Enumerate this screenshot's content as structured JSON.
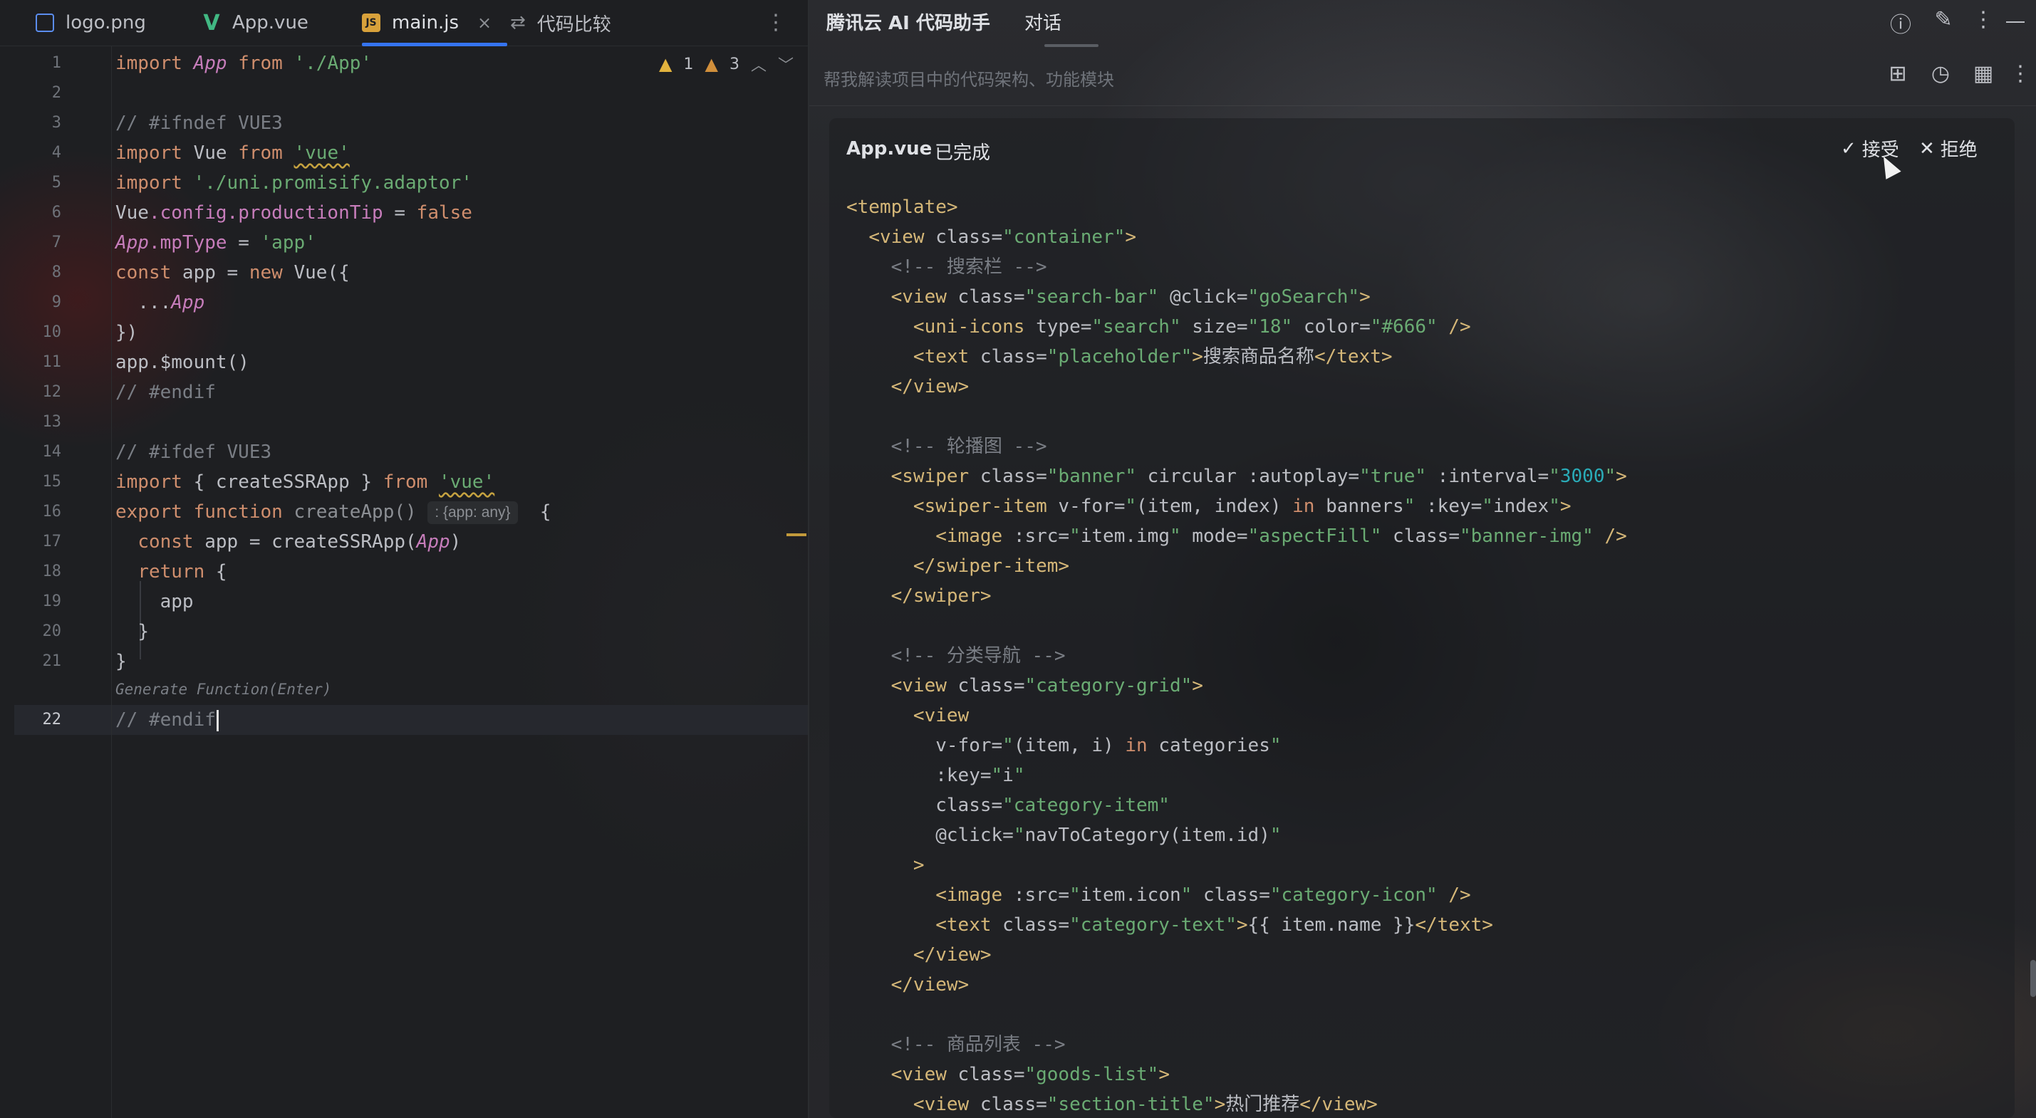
{
  "tabs": [
    {
      "label": "logo.png",
      "icon": "image-file-icon"
    },
    {
      "label": "App.vue",
      "icon": "vue-file-icon"
    },
    {
      "label": "main.js",
      "icon": "js-file-icon",
      "close": "×"
    },
    {
      "label": "代码比较",
      "icon": "diff-icon"
    }
  ],
  "editor": {
    "line_numbers": [
      "1",
      "2",
      "3",
      "4",
      "5",
      "6",
      "7",
      "8",
      "9",
      "10",
      "11",
      "12",
      "13",
      "14",
      "15",
      "16",
      "17",
      "18",
      "19",
      "20",
      "21",
      "22"
    ],
    "inspections": {
      "warn1": "1",
      "warn2": "3"
    },
    "inlay_hint": ": {app: any}",
    "generate_hint": "Generate Function(Enter)",
    "tokens": {
      "import": "import",
      "from": "from",
      "new": "new",
      "false": "false",
      "export": "export",
      "function": "function",
      "return": "return",
      "App": "App",
      "Vue": "Vue",
      "app": "app",
      "p_app": "'./App'",
      "p_vue": "'vue'",
      "p_adaptor": "'./uni.promisify.adaptor'",
      "s_app": "'app'",
      "c_ifndef": "// #ifndef VUE3",
      "c_endif": "// #endif",
      "c_ifdef": "// #ifdef VUE3",
      "config": ".config.",
      "productionTip": "productionTip",
      " eq": " = ",
      "mpType": ".mpType",
      "const": "const",
      "app_eq_new": " app = ",
      "vue_open": " Vue({",
      "spread": "...",
      "close_obj": "})",
      "mount": "app.$mount()",
      "createSSRApp_import": " { createSSRApp } ",
      "createApp": " createApp()",
      "brace_open": "  {",
      "create_call": " app = createSSRApp(",
      "paren_close": ")",
      "ret_brace": " {",
      "close_brace": "}"
    }
  },
  "assistant": {
    "title": "腾讯云 AI 代码助手",
    "tab": "对话",
    "placeholder": "帮我解读项目中的代码架构、功能模块",
    "card": {
      "file": "App.vue",
      "status": "已完成",
      "accept": "接受",
      "reject": "拒绝"
    },
    "code": [
      [
        [
          "tg",
          "<template>"
        ]
      ],
      [
        [
          "tx",
          "  "
        ],
        [
          "tg",
          "<view "
        ],
        [
          "at",
          "class="
        ],
        [
          "av",
          "\"container\""
        ],
        [
          "tg",
          ">"
        ]
      ],
      [
        [
          "tx",
          "    "
        ],
        [
          "hc",
          "<!-- 搜索栏 -->"
        ]
      ],
      [
        [
          "tx",
          "    "
        ],
        [
          "tg",
          "<view "
        ],
        [
          "at",
          "class="
        ],
        [
          "av",
          "\"search-bar\""
        ],
        [
          "at",
          " @click="
        ],
        [
          "av",
          "\"goSearch\""
        ],
        [
          "tg",
          ">"
        ]
      ],
      [
        [
          "tx",
          "      "
        ],
        [
          "tg",
          "<uni-icons "
        ],
        [
          "at",
          "type="
        ],
        [
          "av",
          "\"search\""
        ],
        [
          "at",
          " size="
        ],
        [
          "av",
          "\"18\""
        ],
        [
          "at",
          " color="
        ],
        [
          "av",
          "\"#666\""
        ],
        [
          "tg",
          " />"
        ]
      ],
      [
        [
          "tx",
          "      "
        ],
        [
          "tg",
          "<text "
        ],
        [
          "at",
          "class="
        ],
        [
          "av",
          "\"placeholder\""
        ],
        [
          "tg",
          ">"
        ],
        [
          "tx",
          "搜索商品名称"
        ],
        [
          "tg",
          "</text>"
        ]
      ],
      [
        [
          "tx",
          "    "
        ],
        [
          "tg",
          "</view>"
        ]
      ],
      [
        [
          "tx",
          ""
        ]
      ],
      [
        [
          "tx",
          "    "
        ],
        [
          "hc",
          "<!-- 轮播图 -->"
        ]
      ],
      [
        [
          "tx",
          "    "
        ],
        [
          "tg",
          "<swiper "
        ],
        [
          "at",
          "class="
        ],
        [
          "av",
          "\"banner\""
        ],
        [
          "at",
          " circular :autoplay="
        ],
        [
          "av",
          "\"true\""
        ],
        [
          "at",
          " :interval="
        ],
        [
          "av",
          "\""
        ],
        [
          "num",
          "3000"
        ],
        [
          "av",
          "\""
        ],
        [
          "tg",
          ">"
        ]
      ],
      [
        [
          "tx",
          "      "
        ],
        [
          "tg",
          "<swiper-item "
        ],
        [
          "at",
          "v-for="
        ],
        [
          "av",
          "\""
        ],
        [
          "tx",
          "(item, index) "
        ],
        [
          "in",
          "in"
        ],
        [
          "tx",
          " banners"
        ],
        [
          "av",
          "\""
        ],
        [
          "at",
          " :key="
        ],
        [
          "av",
          "\""
        ],
        [
          "tx",
          "index"
        ],
        [
          "av",
          "\""
        ],
        [
          "tg",
          ">"
        ]
      ],
      [
        [
          "tx",
          "        "
        ],
        [
          "tg",
          "<image "
        ],
        [
          "at",
          ":src="
        ],
        [
          "av",
          "\""
        ],
        [
          "tx",
          "item.img"
        ],
        [
          "av",
          "\""
        ],
        [
          "at",
          " mode="
        ],
        [
          "av",
          "\"aspectFill\""
        ],
        [
          "at",
          " class="
        ],
        [
          "av",
          "\"banner-img\""
        ],
        [
          "tg",
          " />"
        ]
      ],
      [
        [
          "tx",
          "      "
        ],
        [
          "tg",
          "</swiper-item>"
        ]
      ],
      [
        [
          "tx",
          "    "
        ],
        [
          "tg",
          "</swiper>"
        ]
      ],
      [
        [
          "tx",
          ""
        ]
      ],
      [
        [
          "tx",
          "    "
        ],
        [
          "hc",
          "<!-- 分类导航 -->"
        ]
      ],
      [
        [
          "tx",
          "    "
        ],
        [
          "tg",
          "<view "
        ],
        [
          "at",
          "class="
        ],
        [
          "av",
          "\"category-grid\""
        ],
        [
          "tg",
          ">"
        ]
      ],
      [
        [
          "tx",
          "      "
        ],
        [
          "tg",
          "<view"
        ]
      ],
      [
        [
          "tx",
          "        "
        ],
        [
          "at",
          "v-for="
        ],
        [
          "av",
          "\""
        ],
        [
          "tx",
          "(item, i) "
        ],
        [
          "in",
          "in"
        ],
        [
          "tx",
          " categories"
        ],
        [
          "av",
          "\""
        ]
      ],
      [
        [
          "tx",
          "        "
        ],
        [
          "at",
          ":key="
        ],
        [
          "av",
          "\""
        ],
        [
          "tx",
          "i"
        ],
        [
          "av",
          "\""
        ]
      ],
      [
        [
          "tx",
          "        "
        ],
        [
          "at",
          "class="
        ],
        [
          "av",
          "\"category-item\""
        ]
      ],
      [
        [
          "tx",
          "        "
        ],
        [
          "at",
          "@click="
        ],
        [
          "av",
          "\""
        ],
        [
          "tx",
          "navToCategory(item.id)"
        ],
        [
          "av",
          "\""
        ]
      ],
      [
        [
          "tx",
          "      "
        ],
        [
          "tg",
          ">"
        ]
      ],
      [
        [
          "tx",
          "        "
        ],
        [
          "tg",
          "<image "
        ],
        [
          "at",
          ":src="
        ],
        [
          "av",
          "\""
        ],
        [
          "tx",
          "item.icon"
        ],
        [
          "av",
          "\""
        ],
        [
          "at",
          " class="
        ],
        [
          "av",
          "\"category-icon\""
        ],
        [
          "tg",
          " />"
        ]
      ],
      [
        [
          "tx",
          "        "
        ],
        [
          "tg",
          "<text "
        ],
        [
          "at",
          "class="
        ],
        [
          "av",
          "\"category-text\""
        ],
        [
          "tg",
          ">"
        ],
        [
          "tx",
          "{{ item.name }}"
        ],
        [
          "tg",
          "</text>"
        ]
      ],
      [
        [
          "tx",
          "      "
        ],
        [
          "tg",
          "</view>"
        ]
      ],
      [
        [
          "tx",
          "    "
        ],
        [
          "tg",
          "</view>"
        ]
      ],
      [
        [
          "tx",
          ""
        ]
      ],
      [
        [
          "tx",
          "    "
        ],
        [
          "hc",
          "<!-- 商品列表 -->"
        ]
      ],
      [
        [
          "tx",
          "    "
        ],
        [
          "tg",
          "<view "
        ],
        [
          "at",
          "class="
        ],
        [
          "av",
          "\"goods-list\""
        ],
        [
          "tg",
          ">"
        ]
      ],
      [
        [
          "tx",
          "      "
        ],
        [
          "tg",
          "<view "
        ],
        [
          "at",
          "class="
        ],
        [
          "av",
          "\"section-title\""
        ],
        [
          "tg",
          ">"
        ],
        [
          "tx",
          "热门推荐"
        ],
        [
          "tg",
          "</view>"
        ]
      ]
    ]
  }
}
